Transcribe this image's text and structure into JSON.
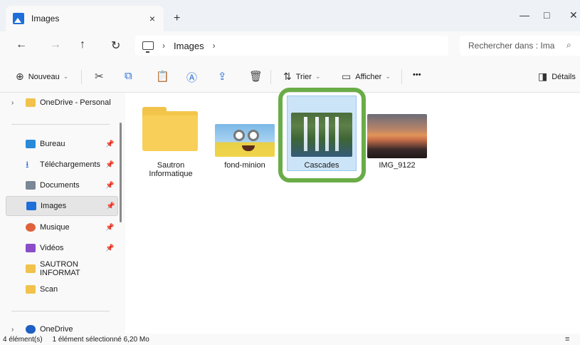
{
  "window": {
    "tab_title": "Images",
    "tab_close": "×",
    "new_tab": "+",
    "minimize": "—",
    "maximize": "□",
    "close": "✕"
  },
  "nav": {
    "back": "←",
    "forward": "→",
    "up": "↑",
    "refresh": "↻",
    "breadcrumb": [
      "Images"
    ],
    "search_placeholder": "Rechercher dans : Ima",
    "search_icon": "⌕"
  },
  "toolbar": {
    "new_label": "Nouveau",
    "sort_label": "Trier",
    "view_label": "Afficher",
    "more_label": "•••",
    "details_label": "Détails"
  },
  "sidebar": {
    "top_item": "OneDrive - Personal",
    "items": [
      {
        "label": "Bureau",
        "icon": "desktop-icon",
        "color": "#2a8ad8"
      },
      {
        "label": "Téléchargements",
        "icon": "download-icon",
        "color": "#2a6fd6"
      },
      {
        "label": "Documents",
        "icon": "document-icon",
        "color": "#7a8797"
      },
      {
        "label": "Images",
        "icon": "images-icon",
        "color": "#1f6fd8"
      },
      {
        "label": "Musique",
        "icon": "music-icon",
        "color": "#e0623c"
      },
      {
        "label": "Vidéos",
        "icon": "videos-icon",
        "color": "#8b4cc9"
      },
      {
        "label": "SAUTRON INFORMAT",
        "icon": "folder-icon",
        "color": "#f1c24c"
      },
      {
        "label": "Scan",
        "icon": "folder-icon",
        "color": "#f1c24c"
      }
    ],
    "bottom_item": "OneDrive"
  },
  "files": [
    {
      "name": "Sautron Informatique",
      "type": "folder"
    },
    {
      "name": "fond-minion",
      "type": "image"
    },
    {
      "name": "Cascades",
      "type": "image",
      "selected": true
    },
    {
      "name": "IMG_9122",
      "type": "image"
    }
  ],
  "status": {
    "count": "4 élément(s)",
    "selection": "1 élément sélectionné  6,20 Mo"
  },
  "colors": {
    "selection_fill": "#cce4f7",
    "highlight_ring": "#6aac47"
  }
}
